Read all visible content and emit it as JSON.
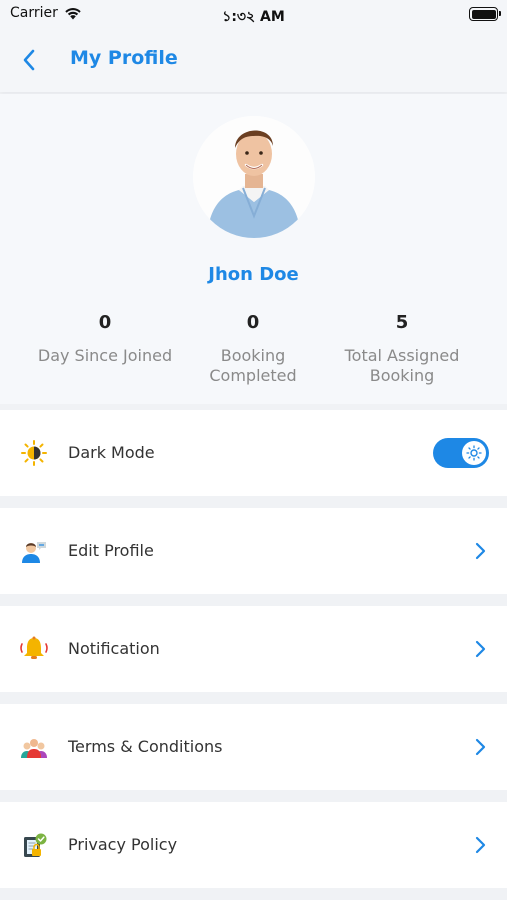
{
  "status_bar": {
    "carrier": "Carrier",
    "time": "১:৩২ AM"
  },
  "header": {
    "title": "My Profile"
  },
  "profile": {
    "name": "Jhon Doe",
    "stats": [
      {
        "value": "0",
        "label_line1": "Day Since Joined",
        "label_line2": ""
      },
      {
        "value": "0",
        "label_line1": "Booking",
        "label_line2": "Completed"
      },
      {
        "value": "5",
        "label_line1": "Total Assigned",
        "label_line2": "Booking"
      }
    ]
  },
  "menu": {
    "dark_mode": {
      "label": "Dark Mode",
      "icon": "sun-moon-icon",
      "enabled": true
    },
    "items": [
      {
        "label": "Edit Profile",
        "icon": "user-edit-icon"
      },
      {
        "label": "Notification",
        "icon": "bell-icon"
      },
      {
        "label": "Terms & Conditions",
        "icon": "people-icon"
      },
      {
        "label": "Privacy Policy",
        "icon": "lock-document-icon"
      }
    ]
  },
  "colors": {
    "accent": "#1e88e5",
    "background": "#f0f2f5"
  }
}
